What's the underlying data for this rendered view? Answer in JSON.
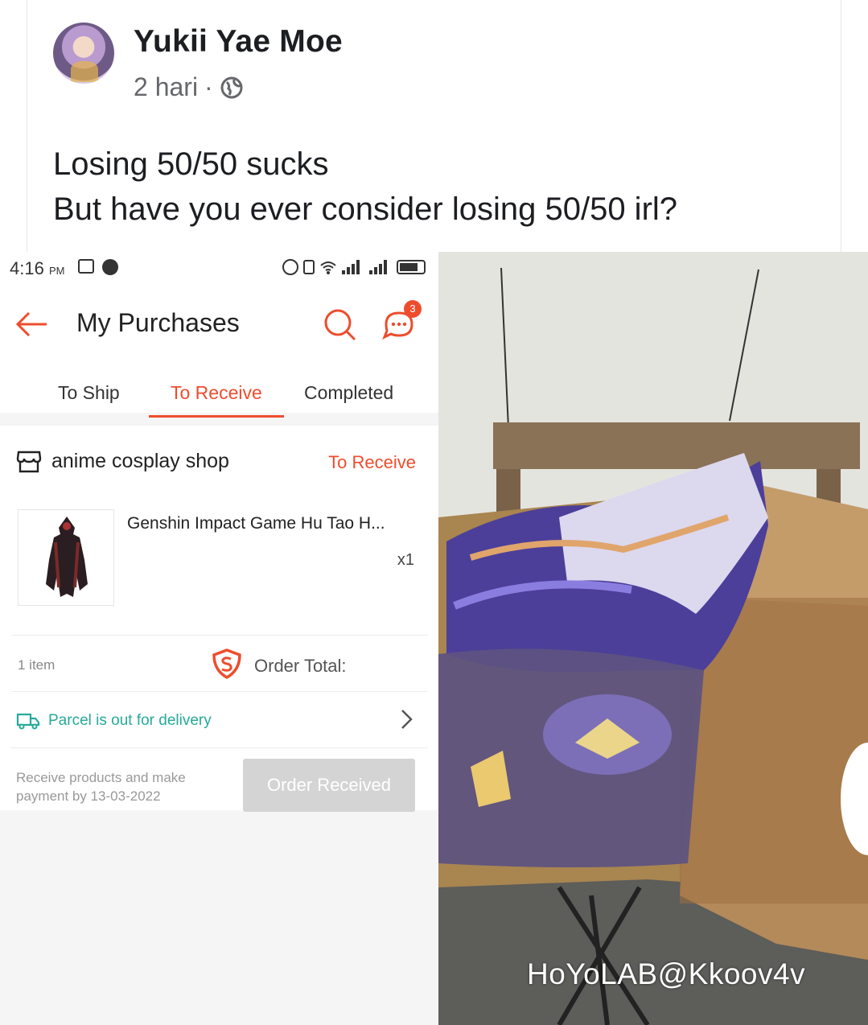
{
  "post": {
    "author": "Yukii Yae Moe",
    "time": "2 hari",
    "separator": "·",
    "text_line1": "Losing 50/50 sucks",
    "text_line2": "But have you ever consider losing 50/50 irl?"
  },
  "phone": {
    "status_time": "4:16",
    "status_ampm": "PM",
    "header_title": "My Purchases",
    "chat_badge": "3",
    "tabs": [
      {
        "label": "To Ship"
      },
      {
        "label": "To Receive",
        "active": true
      },
      {
        "label": "Completed"
      }
    ],
    "order": {
      "shop_name": "anime cosplay shop",
      "status": "To Receive",
      "product_name": "Genshin Impact Game Hu Tao H...",
      "quantity": "x1",
      "item_count": "1 item",
      "order_total_label": "Order Total:",
      "delivery_status": "Parcel is out for delivery",
      "payment_note": "Receive products and make payment by 13-03-2022",
      "button_label": "Order Received"
    }
  },
  "photo": {
    "watermark": "HoYoLAB@Kkoov4v"
  },
  "colors": {
    "accent": "#ee4d2d",
    "delivery": "#26aa99",
    "fb_text": "#1c1e21",
    "fb_meta": "#65676b"
  }
}
